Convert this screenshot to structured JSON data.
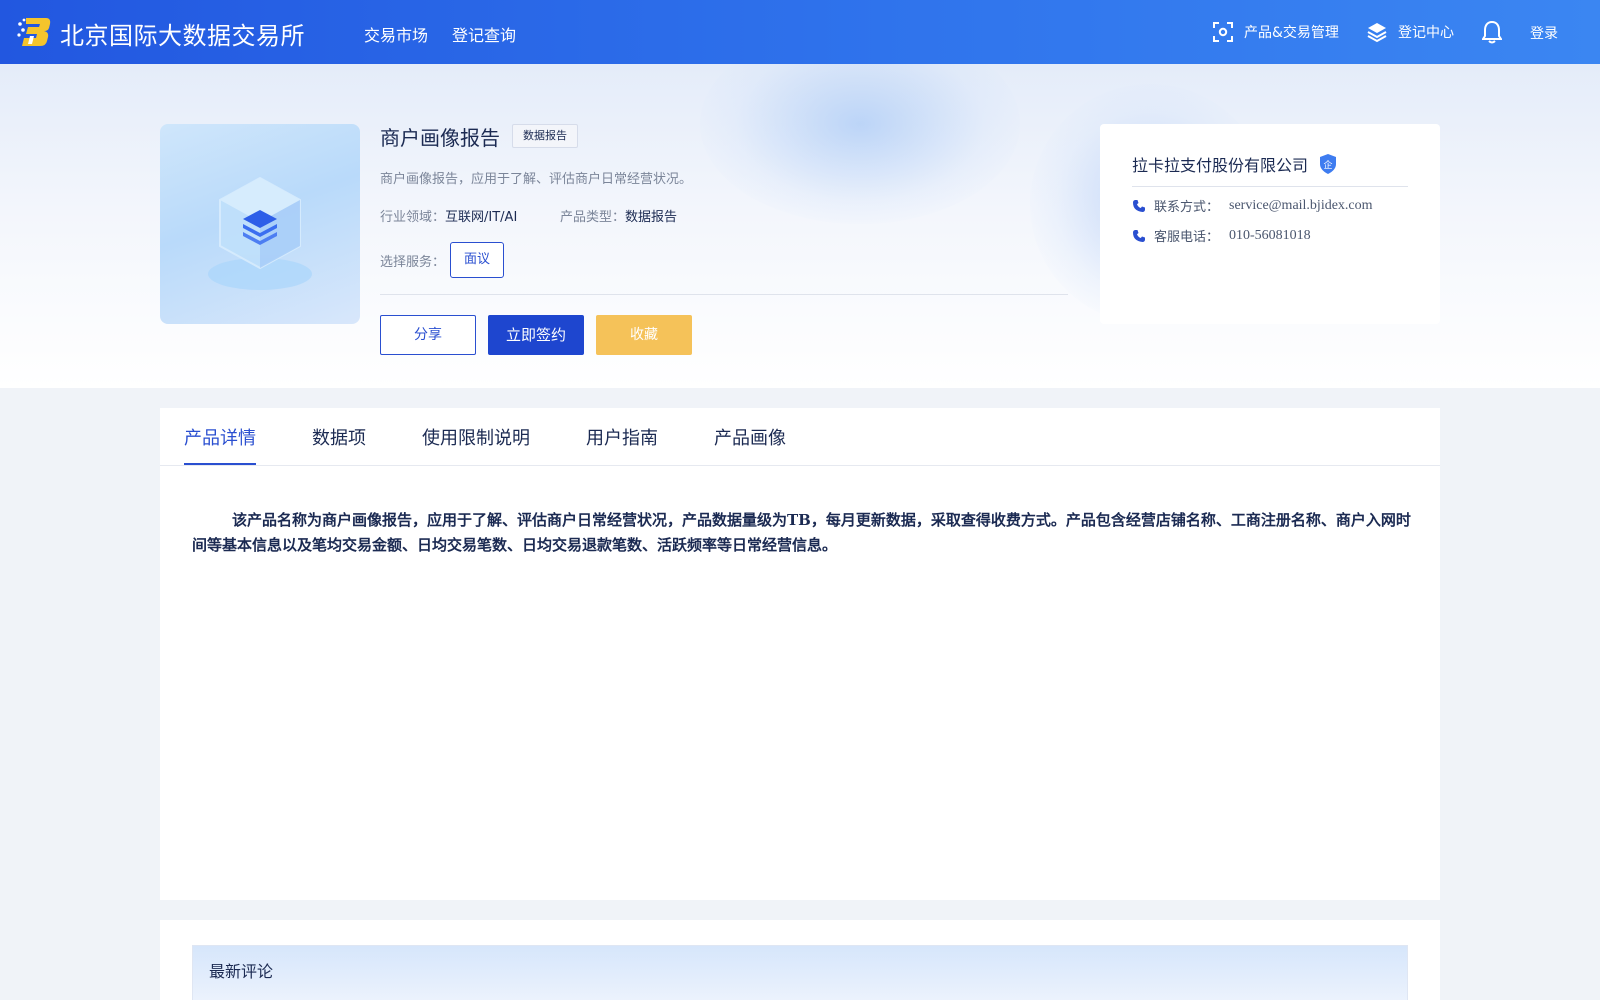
{
  "header": {
    "brand": "北京国际大数据交易所",
    "nav": [
      "交易市场",
      "登记查询"
    ],
    "product_mgmt": "产品&交易管理",
    "register_center": "登记中心",
    "login": "登录"
  },
  "product": {
    "title": "商户画像报告",
    "tag": "数据报告",
    "description": "商户画像报告，应用于了解、评估商户日常经营状况。",
    "industry_label": "行业领域：",
    "industry_value": "互联网/IT/AI",
    "type_label": "产品类型：",
    "type_value": "数据报告",
    "service_label": "选择服务：",
    "service_option": "面议",
    "buttons": {
      "share": "分享",
      "sign": "立即签约",
      "favorite": "收藏"
    }
  },
  "company": {
    "name": "拉卡拉支付股份有限公司",
    "badge": "企",
    "contact_label": "联系方式：",
    "contact_value": "service@mail.bjidex.com",
    "phone_label": "客服电话：",
    "phone_value": "010-56081018"
  },
  "tabs": [
    "产品详情",
    "数据项",
    "使用限制说明",
    "用户指南",
    "产品画像"
  ],
  "active_tab": "产品详情",
  "detail_text": "该产品名称为商户画像报告，应用于了解、评估商户日常经营状况，产品数据量级为TB，每月更新数据，采取查得收费方式。产品包含经营店铺名称、工商注册名称、商户入网时间等基本信息以及笔均交易金额、日均交易笔数、日均交易退款笔数、活跃频率等日常经营信息。",
  "comments": {
    "title": "最新评论"
  },
  "colors": {
    "primary": "#2a4fd0",
    "accent_yellow": "#f5c259",
    "header_start": "#2257e0",
    "header_end": "#3b86f2"
  }
}
